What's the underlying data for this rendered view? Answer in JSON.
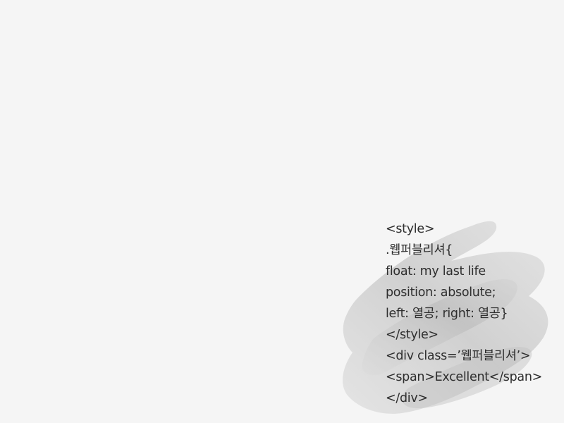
{
  "decoration": {
    "brush_color": "#c9c9c9"
  },
  "code": {
    "lines": [
      "<style>",
      ".웹퍼블리셔{",
      "float: my last life",
      "position: absolute;",
      "left: 열공; right: 열공}",
      "</style>",
      "<div class=’웹퍼블리셔’>",
      "<span>Excellent</span>",
      "</div>"
    ]
  }
}
